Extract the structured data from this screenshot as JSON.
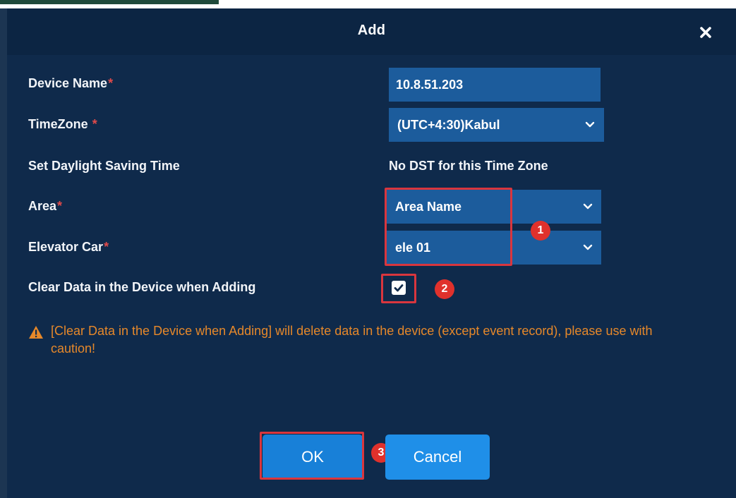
{
  "dialog": {
    "title": "Add",
    "close_icon": "close-icon"
  },
  "form": {
    "device_name": {
      "label": "Device Name",
      "required_mark": "*",
      "value": "10.8.51.203"
    },
    "timezone": {
      "label": "TimeZone ",
      "required_mark": "*",
      "value": "(UTC+4:30)Kabul"
    },
    "dst": {
      "label": "Set Daylight Saving Time",
      "value": "No DST for this Time Zone"
    },
    "area": {
      "label": "Area",
      "required_mark": "*",
      "value": "Area Name"
    },
    "elevator_car": {
      "label": "Elevator Car",
      "required_mark": "*",
      "value": "ele 01"
    },
    "clear_data": {
      "label": "Clear Data in the Device when Adding",
      "checked": true
    }
  },
  "warning": {
    "icon": "warning-icon",
    "text": "[Clear Data in the Device when Adding] will delete data in the device (except event record), please use with caution!"
  },
  "buttons": {
    "ok_label": "OK",
    "cancel_label": "Cancel"
  },
  "annotations": {
    "step1": "1",
    "step2": "2",
    "step3": "3",
    "highlight_color": "#d9363e"
  },
  "colors": {
    "dialog_bg": "#0f2a4b",
    "field_bg": "#1c5c9c",
    "button_blue": "#1880d8",
    "warning_orange": "#e6882a",
    "required_red": "#e04a4a"
  }
}
